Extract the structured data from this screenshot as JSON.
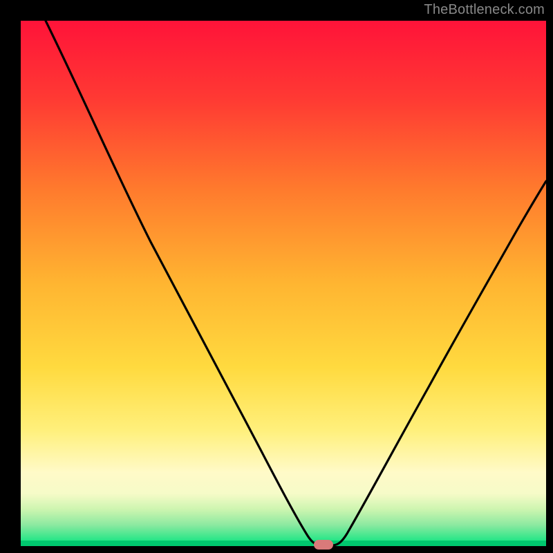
{
  "watermark": "TheBottleneck.com",
  "colors": {
    "frame": "#000000",
    "gradient_top": "#ff1339",
    "gradient_mid_upper": "#ff7a2d",
    "gradient_mid": "#ffb531",
    "gradient_mid_lower": "#ffe759",
    "gradient_low": "#fffac8",
    "gradient_green_light": "#b9f5a6",
    "gradient_green": "#00e57e",
    "curve": "#000000",
    "marker": "#d97a7a"
  },
  "chart_data": {
    "type": "line",
    "title": "",
    "xlabel": "",
    "ylabel": "",
    "xlim": [
      0,
      100
    ],
    "ylim": [
      0,
      100
    ],
    "x": [
      0,
      5,
      10,
      15,
      20,
      25,
      30,
      35,
      40,
      45,
      50,
      52,
      54,
      56,
      58,
      60,
      65,
      70,
      75,
      80,
      85,
      90,
      95,
      100
    ],
    "values": [
      100,
      93,
      86,
      79,
      71,
      63,
      55,
      46,
      37,
      27,
      15,
      8,
      2,
      0,
      0,
      4,
      15,
      27,
      37,
      46,
      54,
      60,
      65,
      69
    ],
    "series": [
      {
        "name": "bottleneck-curve",
        "x_ref": "x",
        "y_ref": "values"
      }
    ],
    "marker": {
      "x": 56.5,
      "y": 0,
      "label": ""
    }
  }
}
